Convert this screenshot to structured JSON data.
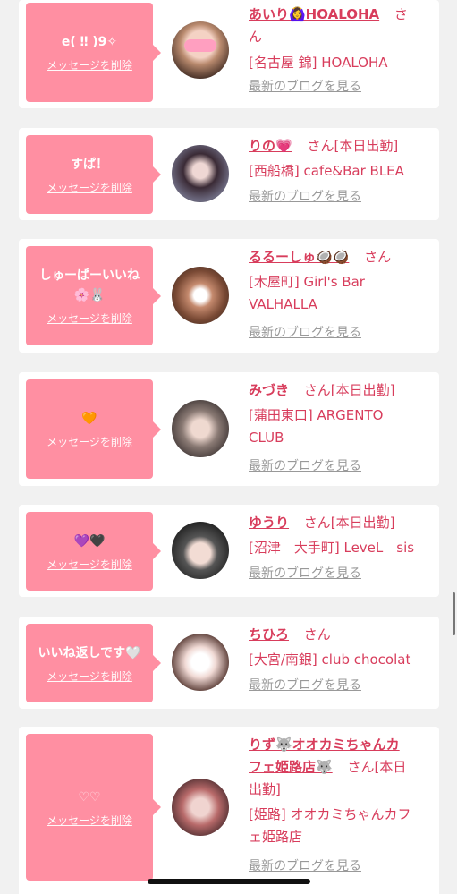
{
  "delete_label": "メッセージを削除",
  "blog_label": "最新のブログを見る",
  "cards": [
    {
      "msg": [
        "e( ‼ )9✧"
      ],
      "name": "あいり🙆‍♀️HOALOHA",
      "san": "さ",
      "shop": "ん",
      "shop2": "[名古屋 錦] HOALOHA"
    },
    {
      "msg": [
        "すぱ！"
      ],
      "name": "りの💗",
      "san": "さん[本日出勤]",
      "shop": "[西船橋] cafe&Bar BLEA"
    },
    {
      "msg": [
        "しゅーぱーいいね",
        "🌸🐰"
      ],
      "name": "るるーしゅ🥥🥥",
      "san": "さん",
      "shop": "[木屋町] Girl's Bar",
      "shop2": "VALHALLA"
    },
    {
      "msg": [
        "🧡"
      ],
      "name": "みづき",
      "san": "さん[本日出勤]",
      "shop": "[蒲田東口] ARGENTO",
      "shop2": "CLUB"
    },
    {
      "msg": [
        "💜🖤"
      ],
      "name": "ゆうり",
      "san": "さん[本日出勤]",
      "shop": "[沼津　大手町] LeveL　sis"
    },
    {
      "msg": [
        "いいね返しです🤍"
      ],
      "name": "ちひろ",
      "san": "さん",
      "shop": "[大宮/南銀] club chocolat"
    },
    {
      "msg": [
        "♡♡"
      ],
      "name": "りず🐺オオカミちゃんカ",
      "name2": "フェ姫路店🐺",
      "san": "さん[本日",
      "san2": "出勤]",
      "shop": "[姫路] オオカミちゃんカフ",
      "shop2": "ェ姫路店"
    }
  ]
}
